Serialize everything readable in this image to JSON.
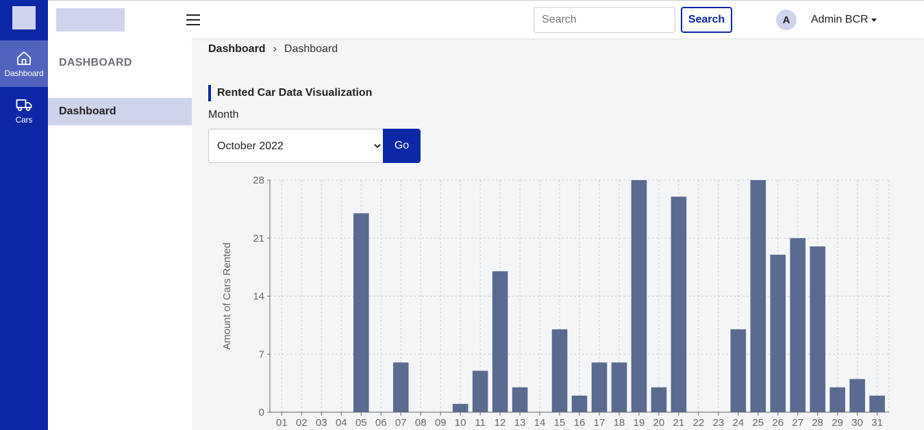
{
  "rail": {
    "items": [
      {
        "label": "Dashboard",
        "icon": "home-icon",
        "active": true
      },
      {
        "label": "Cars",
        "icon": "truck-icon",
        "active": false
      }
    ]
  },
  "header": {
    "search_placeholder": "Search",
    "search_button": "Search",
    "avatar_initial": "A",
    "user_name": "Admin BCR"
  },
  "subnav": {
    "title": "DASHBOARD",
    "items": [
      {
        "label": "Dashboard"
      }
    ]
  },
  "breadcrumb": {
    "parent": "Dashboard",
    "current": "Dashboard"
  },
  "section": {
    "title": "Rented Car Data Visualization",
    "month_label": "Month",
    "month_selected": "October 2022",
    "go_button": "Go"
  },
  "colors": {
    "primary": "#0d28a6",
    "bar": "#5a6b91",
    "light_accent": "#cfd4ec"
  },
  "chart_data": {
    "type": "bar",
    "ylabel": "Amount of Cars Rented",
    "xlabel": "",
    "ylim": [
      0,
      28
    ],
    "yticks": [
      0,
      7,
      14,
      21,
      28
    ],
    "grid": true,
    "categories": [
      "01",
      "02",
      "03",
      "04",
      "05",
      "06",
      "07",
      "08",
      "09",
      "10",
      "11",
      "12",
      "13",
      "14",
      "15",
      "16",
      "17",
      "18",
      "19",
      "20",
      "21",
      "22",
      "23",
      "24",
      "25",
      "26",
      "27",
      "28",
      "29",
      "30",
      "31"
    ],
    "values": [
      0,
      0,
      0,
      0,
      24,
      0,
      6,
      0,
      0,
      1,
      5,
      17,
      3,
      0,
      10,
      2,
      6,
      6,
      28,
      3,
      26,
      0,
      0,
      10,
      28,
      19,
      21,
      20,
      3,
      4,
      2
    ]
  }
}
